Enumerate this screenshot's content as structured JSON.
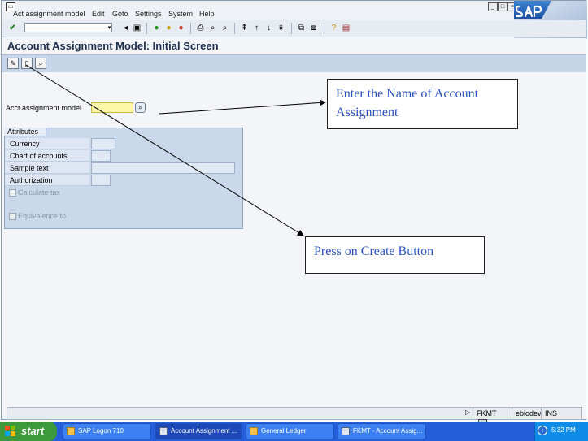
{
  "menu": {
    "items": [
      "Act assignment model",
      "Edit",
      "Goto",
      "Settings",
      "System",
      "Help"
    ]
  },
  "screen_title": "Account Assignment Model: Initial Screen",
  "form": {
    "model_label": "Acct assignment model",
    "model_value": ""
  },
  "attributes": {
    "tab_label": "Attributes",
    "fields": [
      "Currency",
      "Chart of accounts",
      "Sample text",
      "Authorization"
    ],
    "checkboxes": [
      "Calculate tax",
      "Equivalence to"
    ]
  },
  "callouts": {
    "enter_name": "Enter the Name of Account Assignment",
    "press_create": "Press on Create Button"
  },
  "statusbar": {
    "tcode": "FKMT",
    "server": "ebiodev",
    "mode": "INS"
  },
  "taskbar": {
    "start_label": "start",
    "tasks": [
      "SAP Logon 710",
      "Account Assignment ...",
      "General Ledger",
      "FKMT - Account Assig..."
    ],
    "clock": "5:32 PM"
  },
  "colors": {
    "title": "#1d2f4f",
    "required_field": "#fff7a8",
    "callout_text": "#2b4fc4",
    "taskbar": "#245edb"
  }
}
